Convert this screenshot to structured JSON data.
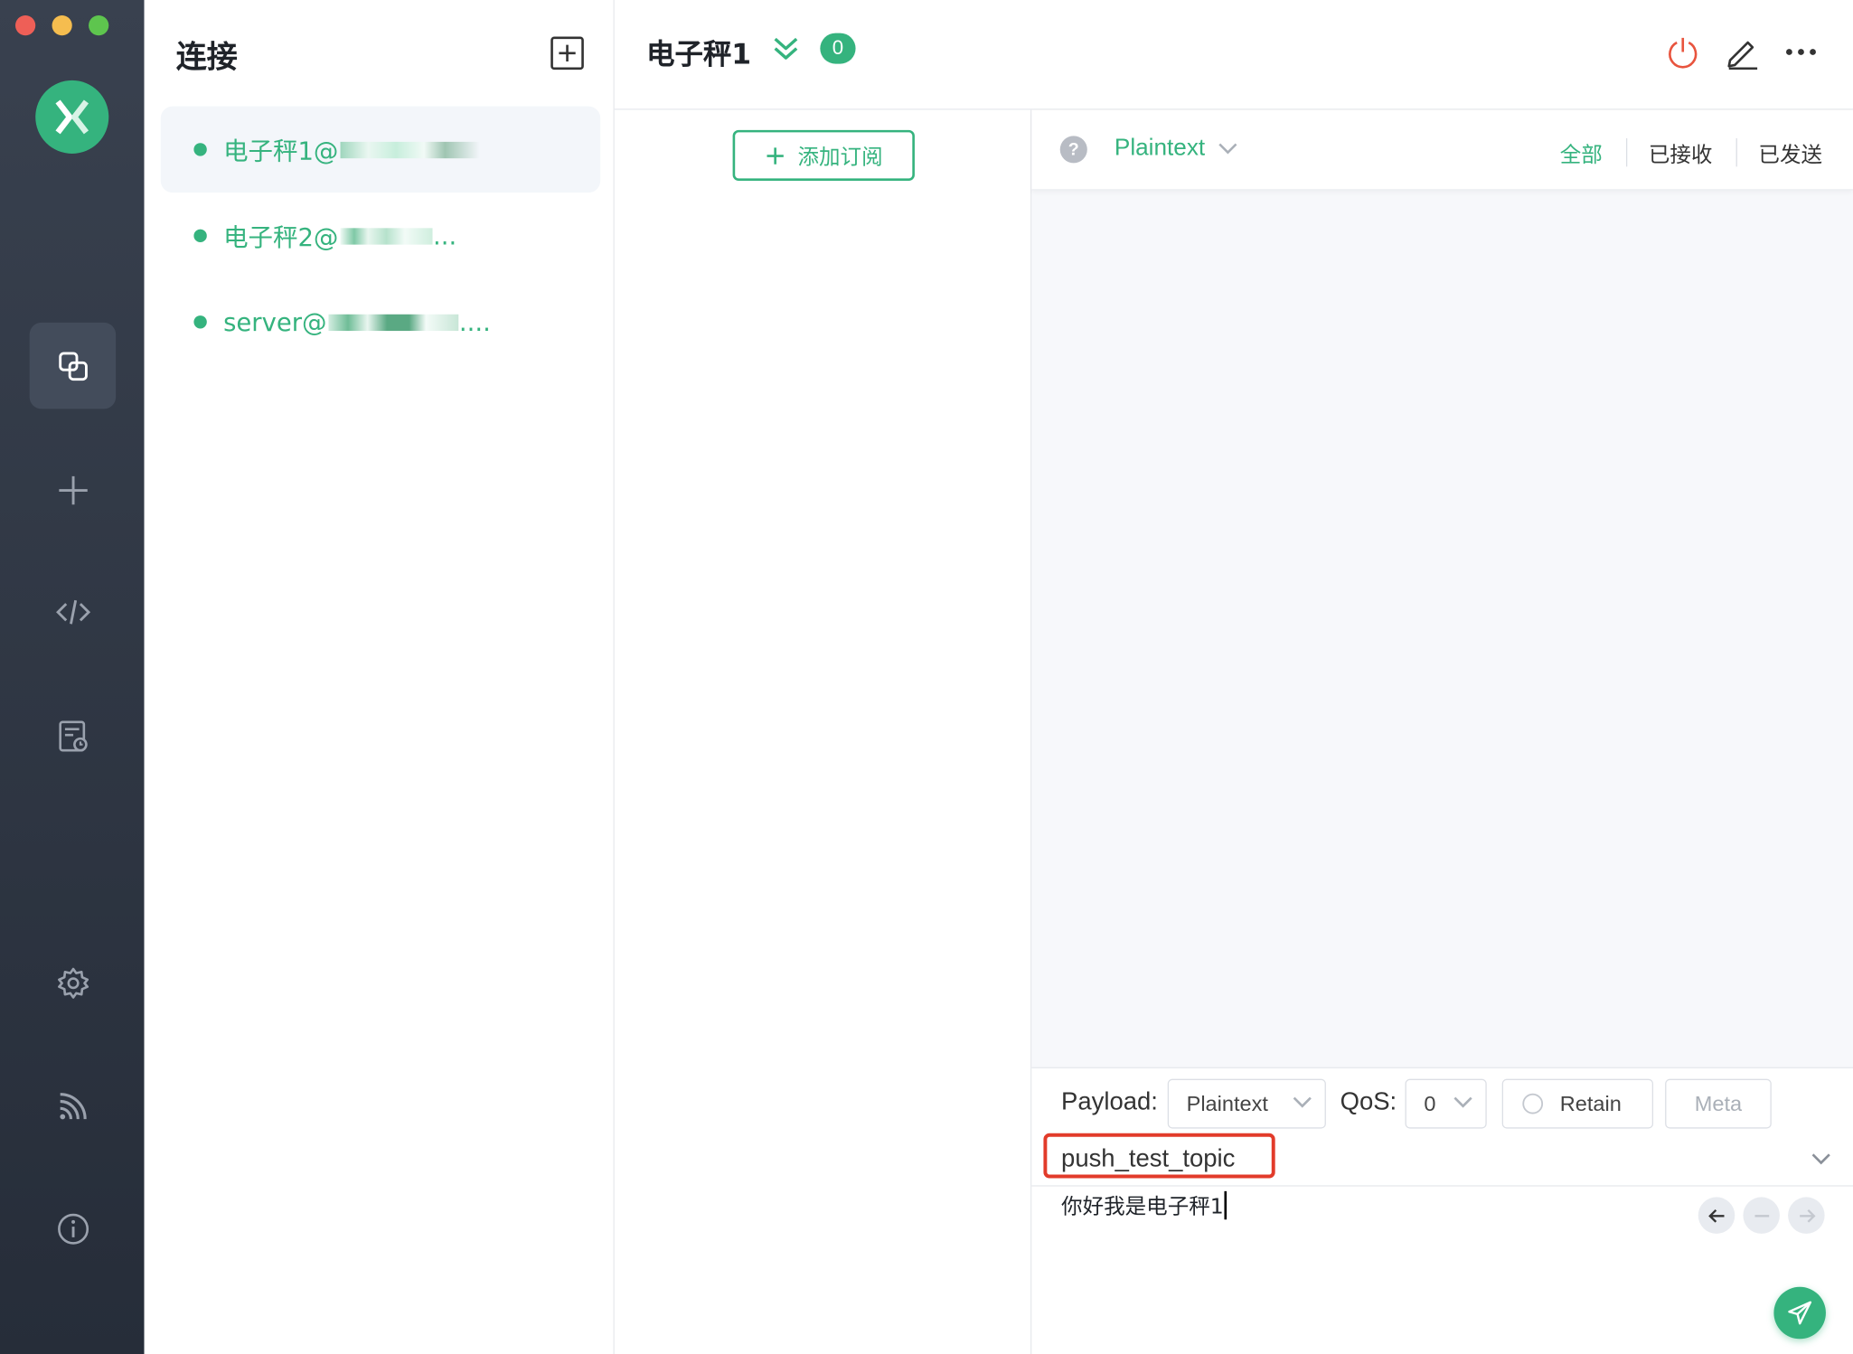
{
  "window": {
    "traffic_lights": [
      "close",
      "minimize",
      "maximize"
    ]
  },
  "rail": {
    "logo": "mqttx-logo",
    "items": [
      {
        "name": "connections",
        "icon": "connections-icon",
        "active": true
      },
      {
        "name": "new-connection",
        "icon": "plus-icon",
        "active": false
      },
      {
        "name": "script",
        "icon": "code-icon",
        "active": false
      },
      {
        "name": "log",
        "icon": "log-icon",
        "active": false
      },
      {
        "name": "settings",
        "icon": "gear-icon",
        "active": false
      },
      {
        "name": "subscriptions-feed",
        "icon": "rss-icon",
        "active": false
      },
      {
        "name": "about",
        "icon": "info-icon",
        "active": false
      }
    ]
  },
  "connections": {
    "title": "连接",
    "items": [
      {
        "label": "电子秤1@",
        "suffix": "",
        "active": true,
        "status_color": "#35b37e"
      },
      {
        "label": "电子秤2@",
        "suffix": "...",
        "active": false,
        "status_color": "#35b37e"
      },
      {
        "label": "server@",
        "suffix": "....",
        "active": false,
        "status_color": "#35b37e"
      }
    ]
  },
  "header": {
    "title": "电子秤1",
    "badge": "0"
  },
  "subscriptions": {
    "add_label": "添加订阅"
  },
  "messages": {
    "help": "?",
    "format": "Plaintext",
    "filters": {
      "all": "全部",
      "received": "已接收",
      "sent": "已发送"
    }
  },
  "publish": {
    "payload_label": "Payload:",
    "payload_format": "Plaintext",
    "qos_label": "QoS:",
    "qos_value": "0",
    "retain_label": "Retain",
    "meta_label": "Meta",
    "topic": "push_test_topic",
    "payload": "你好我是电子秤1"
  },
  "colors": {
    "accent": "#35b37e",
    "rail": "#2f3643",
    "highlight": "#e23b2a",
    "disconnect": "#e8543e"
  }
}
